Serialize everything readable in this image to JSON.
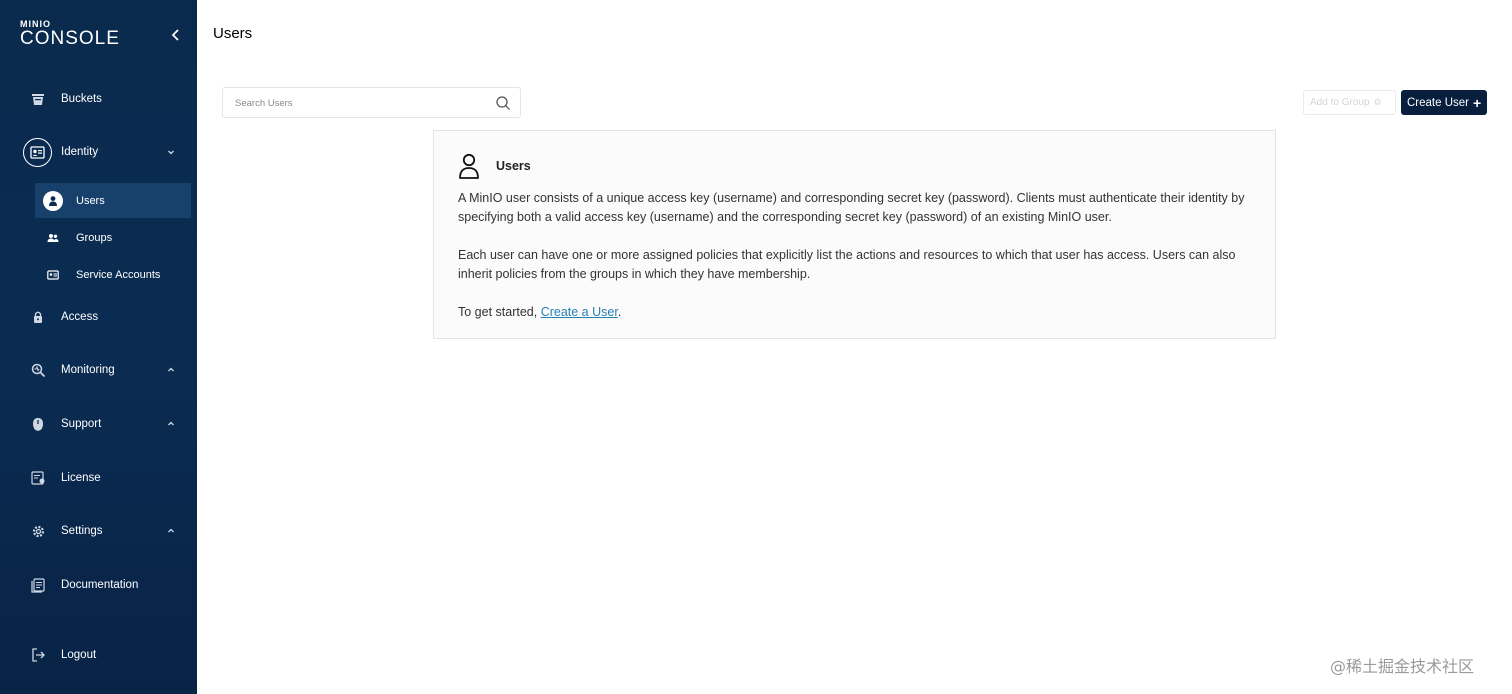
{
  "sidebar": {
    "logo_small": "MINIO",
    "logo_big": "CONSOLE",
    "items": [
      {
        "label": "Buckets",
        "icon": "bucket-icon"
      },
      {
        "label": "Identity",
        "icon": "identity-icon"
      },
      {
        "label": "Access",
        "icon": "lock-icon"
      },
      {
        "label": "Monitoring",
        "icon": "monitoring-icon"
      },
      {
        "label": "Support",
        "icon": "support-icon"
      },
      {
        "label": "License",
        "icon": "license-icon"
      },
      {
        "label": "Settings",
        "icon": "gear-icon"
      },
      {
        "label": "Documentation",
        "icon": "documentation-icon"
      },
      {
        "label": "Logout",
        "icon": "logout-icon"
      }
    ],
    "identity_sub": [
      {
        "label": "Users",
        "icon": "user-icon",
        "active": true
      },
      {
        "label": "Groups",
        "icon": "groups-icon"
      },
      {
        "label": "Service Accounts",
        "icon": "service-accounts-icon"
      }
    ]
  },
  "header": {
    "title": "Users"
  },
  "search": {
    "placeholder": "Search Users",
    "value": ""
  },
  "actions": {
    "add_to_group": "Add to Group",
    "create_user": "Create User"
  },
  "card": {
    "title": "Users",
    "p1": "A MinIO user consists of a unique access key (username) and corresponding secret key (password). Clients must authenticate their identity by specifying both a valid access key (username) and the corresponding secret key (password) of an existing MinIO user.",
    "p2": "Each user can have one or more assigned policies that explicitly list the actions and resources to which that user has access. Users can also inherit policies from the groups in which they have membership.",
    "p3_prefix": "To get started, ",
    "p3_link": "Create a User",
    "p3_suffix": "."
  },
  "watermark": "@稀土掘金技术社区",
  "colors": {
    "sidebar_bg": "#0b2c52",
    "active_item_bg": "#17406a",
    "primary_button": "#071e3d",
    "link": "#2781b0"
  }
}
